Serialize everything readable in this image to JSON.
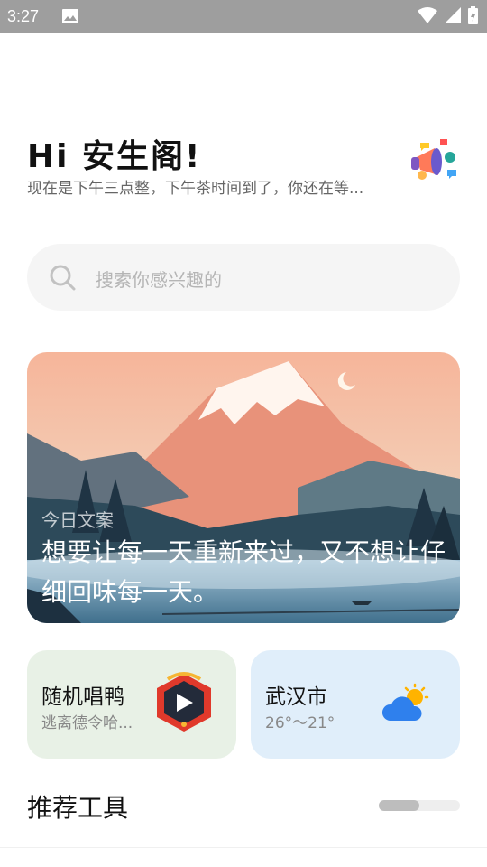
{
  "status_bar": {
    "time": "3:27"
  },
  "header": {
    "greeting": "Hi 安生阁!",
    "subtitle": "现在是下午三点整，下午茶时间到了，你还在等..."
  },
  "search": {
    "placeholder": "搜索你感兴趣的"
  },
  "banner": {
    "caption": "今日文案",
    "quote": "想要让每一天重新来过，又不想让仔细回味每一天。"
  },
  "music_card": {
    "title": "随机唱鸭",
    "subtitle": "逃离德令哈..."
  },
  "weather_card": {
    "title": "武汉市",
    "temperature": "26°～21°"
  },
  "tools": {
    "title": "推荐工具",
    "scroll_progress": 0.5
  },
  "colors": {
    "status_bar": "#9e9e9e",
    "music_card_bg": "#e8f1e6",
    "weather_card_bg": "#e0eefa",
    "search_bg": "#f5f5f5"
  },
  "icons": [
    "image-icon",
    "wifi-icon",
    "signal-icon",
    "battery-icon",
    "megaphone-icon",
    "search-icon",
    "play-icon",
    "cloud-sun-icon"
  ]
}
